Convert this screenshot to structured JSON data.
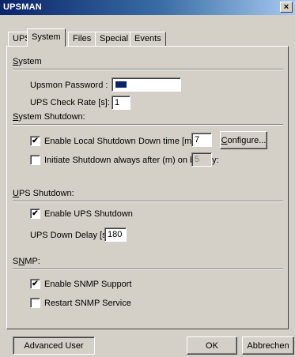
{
  "window": {
    "title": "UPSMAN",
    "close_glyph": "×"
  },
  "tabs": [
    {
      "label": "UPS",
      "active": false
    },
    {
      "label": "System",
      "active": true
    },
    {
      "label": "Files",
      "active": false
    },
    {
      "label": "Special",
      "active": false
    },
    {
      "label": "Events",
      "active": false
    }
  ],
  "system": {
    "heading_mnemonic": "S",
    "heading_rest": "ystem",
    "password_label": "Upsmon Password :",
    "password_value": "xxxxx",
    "check_rate_label": "UPS Check Rate [s]:",
    "check_rate_value": "1"
  },
  "system_shutdown": {
    "heading_mnemonic": "S",
    "heading_rest": "ystem Shutdown:",
    "enable_local_label": "Enable Local Shutdown",
    "enable_local_checked": true,
    "down_time_label": "Down time [m]:",
    "down_time_value": "7",
    "configure_mnemonic": "C",
    "configure_rest": "onfigure...",
    "initiate_label": "Initiate Shutdown always after (m) on battery:",
    "initiate_checked": false,
    "initiate_value": "5"
  },
  "ups_shutdown": {
    "heading_mnemonic": "U",
    "heading_rest": "PS Shutdown:",
    "enable_label": "Enable UPS Shutdown",
    "enable_checked": true,
    "delay_label": "UPS Down Delay [s]:",
    "delay_value": "180"
  },
  "snmp": {
    "heading_pre": "S",
    "heading_mnemonic": "N",
    "heading_rest": "MP:",
    "enable_label": "Enable SNMP Support",
    "enable_checked": true,
    "restart_label": "Restart SNMP Service",
    "restart_checked": false
  },
  "footer": {
    "advanced_user_label": "Advanced User",
    "ok_label": "OK",
    "cancel_label": "Abbrechen"
  },
  "colors": {
    "titlebar_start": "#0a246a",
    "titlebar_end": "#a6caf0",
    "face": "#d4d0c8"
  },
  "icons": {
    "close": "close-icon",
    "check": "check-icon"
  }
}
